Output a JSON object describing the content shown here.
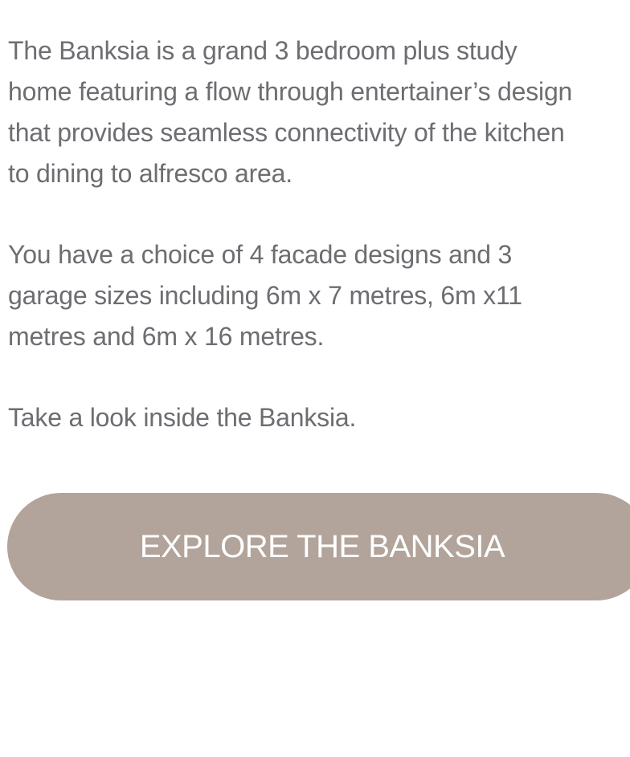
{
  "description": {
    "paragraph_1": [
      "The Banksia is a grand 3 bedroom plus study",
      "home featuring a flow through entertainer’s design",
      "that provides seamless connectivity of the kitchen",
      "to dining to alfresco area."
    ],
    "paragraph_2": [
      "You have a choice of 4 facade designs and 3",
      "garage sizes including 6m x 7 metres, 6m x11",
      "metres and 6m x 16 metres."
    ],
    "paragraph_3": [
      "Take a look inside the Banksia."
    ]
  },
  "cta": {
    "label": "EXPLORE THE BANKSIA",
    "background_color": "#b2a39b",
    "text_color": "#ffffff"
  },
  "colors": {
    "body_text": "#6d6d72",
    "page_background": "#ffffff"
  }
}
